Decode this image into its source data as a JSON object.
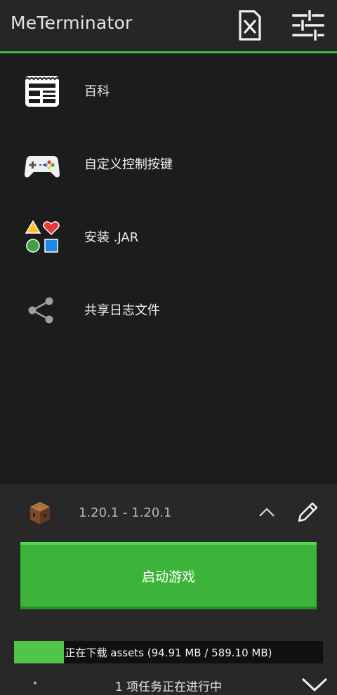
{
  "app": {
    "title": "MeTerminator"
  },
  "toolbar": {
    "delete_icon": "delete-x-icon",
    "settings_icon": "sliders-icon"
  },
  "menu": {
    "items": [
      {
        "label": "百科",
        "icon": "wiki-icon"
      },
      {
        "label": "自定义控制按键",
        "icon": "gamepad-icon"
      },
      {
        "label": "安装 .JAR",
        "icon": "shapes-icon"
      },
      {
        "label": "共享日志文件",
        "icon": "share-icon"
      }
    ]
  },
  "profile": {
    "version": "1.20.1 - 1.20.1",
    "icon": "crafting-table-icon"
  },
  "launch": {
    "label": "启动游戏"
  },
  "download": {
    "text": "正在下载 assets (94.91 MB / 589.10 MB)",
    "progress": 0.161
  },
  "tasks": {
    "text": "1 项任务正在进行中"
  },
  "colors": {
    "accent": "#3fbf3f",
    "launch": "#3cb43a",
    "progress": "#4fc54a"
  }
}
